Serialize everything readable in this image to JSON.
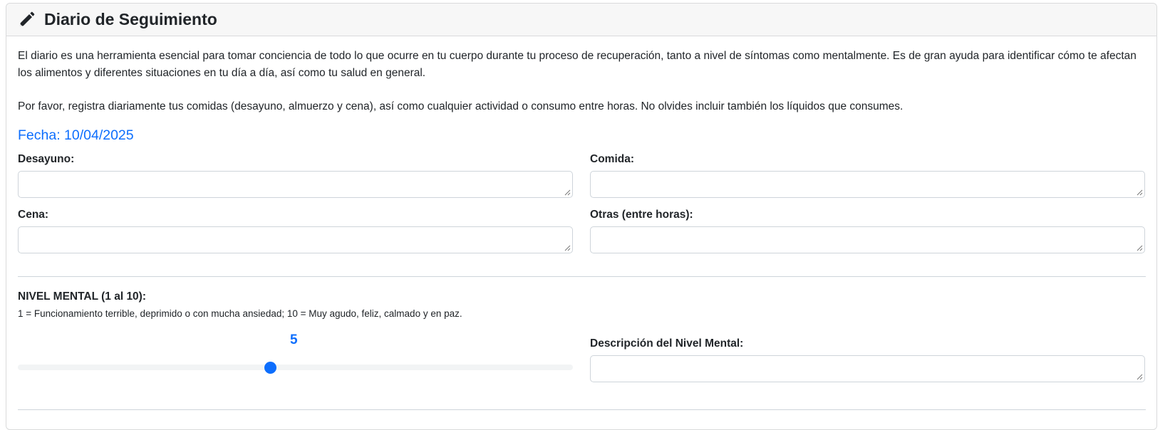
{
  "header": {
    "icon": "pencil-icon",
    "title": "Diario de Seguimiento"
  },
  "intro": {
    "paragraph1": "El diario es una herramienta esencial para tomar conciencia de todo lo que ocurre en tu cuerpo durante tu proceso de recuperación, tanto a nivel de síntomas como mentalmente. Es de gran ayuda para identificar cómo te afectan los alimentos y diferentes situaciones en tu día a día, así como tu salud en general.",
    "paragraph2": "Por favor, registra diariamente tus comidas (desayuno, almuerzo y cena), así como cualquier actividad o consumo entre horas. No olvides incluir también los líquidos que consumes."
  },
  "date_label": "Fecha: 10/04/2025",
  "meals": {
    "breakfast_label": "Desayuno:",
    "breakfast_value": "",
    "lunch_label": "Comida:",
    "lunch_value": "",
    "dinner_label": "Cena:",
    "dinner_value": "",
    "other_label": "Otras (entre horas):",
    "other_value": ""
  },
  "mental": {
    "title": "NIVEL MENTAL (1 al 10):",
    "description": "1 = Funcionamiento terrible, deprimido o con mucha ansiedad; 10 = Muy agudo, feliz, calmado y en paz.",
    "slider_value": "5",
    "slider_min": 1,
    "slider_max": 10,
    "desc_label": "Descripción del Nivel Mental:",
    "desc_value": ""
  },
  "colors": {
    "accent": "#0d6efd",
    "text": "#212529",
    "border": "#ced4da",
    "header_bg": "#f7f7f7"
  }
}
